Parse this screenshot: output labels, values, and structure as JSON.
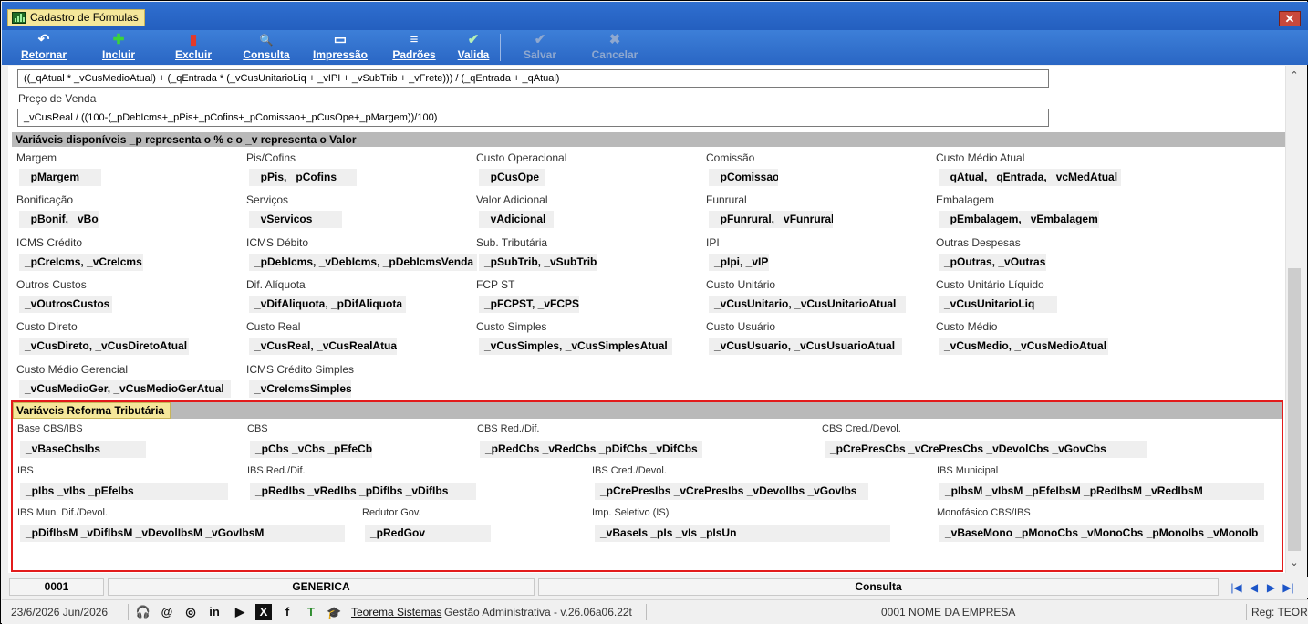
{
  "window": {
    "title": "Cadastro de Fórmulas",
    "close_glyph": "✕"
  },
  "toolbar": {
    "buttons": [
      {
        "label": "Retornar",
        "icon": "↶"
      },
      {
        "label": "Incluir",
        "icon": "✚"
      },
      {
        "label": "Excluir",
        "icon": "▮"
      },
      {
        "label": "Consulta",
        "icon": "🔍"
      },
      {
        "label": "Impressão",
        "icon": "▭"
      },
      {
        "label": "Padrões",
        "icon": "≡"
      },
      {
        "label": "Valida",
        "icon": "✔"
      },
      {
        "label": "Salvar",
        "icon": "✔"
      },
      {
        "label": "Cancelar",
        "icon": "✖"
      }
    ]
  },
  "formulas": {
    "custo_medio": "((_qAtual * _vCusMedioAtual) + (_qEntrada * (_vCusUnitarioLiq + _vIPI + _vSubTrib + _vFrete))) / (_qEntrada + _qAtual)",
    "preco_venda_label": "Preço de Venda",
    "preco_venda": "_vCusReal / ((100-(_pDebIcms+_pPis+_pCofins+_pComissao+_pCusOpe+_pMargem))/100)"
  },
  "variables": {
    "header": "Variáveis disponíveis _p representa o % e o _v representa o Valor",
    "items": [
      {
        "label": "Margem",
        "value": "_pMargem"
      },
      {
        "label": "Pis/Cofins",
        "value": "_pPis, _pCofins"
      },
      {
        "label": "Custo Operacional",
        "value": "_pCusOpe"
      },
      {
        "label": "Comissão",
        "value": "_pComissao"
      },
      {
        "label": "Custo Médio Atual",
        "value": "_qAtual, _qEntrada, _vcMedAtual"
      },
      {
        "label": "Bonificação",
        "value": "_pBonif, _vBonif"
      },
      {
        "label": "Serviços",
        "value": "_vServicos"
      },
      {
        "label": "Valor Adicional",
        "value": "_vAdicional"
      },
      {
        "label": "Funrural",
        "value": "_pFunrural, _vFunrural"
      },
      {
        "label": "Embalagem",
        "value": "_pEmbalagem, _vEmbalagem"
      },
      {
        "label": "ICMS Crédito",
        "value": "_pCreIcms, _vCreIcms"
      },
      {
        "label": "ICMS Débito",
        "value": "_pDebIcms, _vDebIcms, _pDebIcmsVenda"
      },
      {
        "label": "Sub. Tributária",
        "value": "_pSubTrib, _vSubTrib"
      },
      {
        "label": "IPI",
        "value": "_pIpi, _vIPI"
      },
      {
        "label": "Outras Despesas",
        "value": "_pOutras, _vOutras"
      },
      {
        "label": "Outros Custos",
        "value": "_vOutrosCustos"
      },
      {
        "label": "Dif. Alíquota",
        "value": "_vDifAliquota, _pDifAliquota"
      },
      {
        "label": "FCP ST",
        "value": "_pFCPST, _vFCPST"
      },
      {
        "label": "Custo Unitário",
        "value": "_vCusUnitario, _vCusUnitarioAtual"
      },
      {
        "label": "Custo Unitário Líquido",
        "value": "_vCusUnitarioLiq"
      },
      {
        "label": "Custo Direto",
        "value": "_vCusDireto, _vCusDiretoAtual"
      },
      {
        "label": "Custo Real",
        "value": "_vCusReal, _vCusRealAtual"
      },
      {
        "label": "Custo Simples",
        "value": "_vCusSimples, _vCusSimplesAtual"
      },
      {
        "label": "Custo Usuário",
        "value": "_vCusUsuario, _vCusUsuarioAtual"
      },
      {
        "label": "Custo Médio",
        "value": "_vCusMedio, _vCusMedioAtual"
      },
      {
        "label": "Custo Médio Gerencial",
        "value": "_vCusMedioGer, _vCusMedioGerAtual"
      },
      {
        "label": "ICMS Crédito Simples",
        "value": "_vCreIcmsSimples"
      }
    ]
  },
  "reforma": {
    "header": "Variáveis Reforma Tributária",
    "items": [
      {
        "label": "Base CBS/IBS",
        "value": "_vBaseCbsIbs"
      },
      {
        "label": "CBS",
        "value": "_pCbs _vCbs _pEfeCbs"
      },
      {
        "label": "CBS Red./Dif.",
        "value": "_pRedCbs _vRedCbs _pDifCbs _vDifCbs"
      },
      {
        "label": "CBS Cred./Devol.",
        "value": "_pCrePresCbs _vCrePresCbs _vDevolCbs _vGovCbs"
      },
      {
        "label": "IBS",
        "value": "_pIbs _vIbs _pEfeIbs"
      },
      {
        "label": "IBS Red./Dif.",
        "value": "_pRedIbs _vRedIbs _pDifIbs _vDifIbs"
      },
      {
        "label": "IBS Cred./Devol.",
        "value": "_pCrePresIbs _vCrePresIbs _vDevolIbs _vGovIbs"
      },
      {
        "label": "IBS Municipal",
        "value": "_pIbsM _vIbsM _pEfeIbsM _pRedIbsM _vRedIbsM"
      },
      {
        "label": "IBS Mun. Dif./Devol.",
        "value": "_pDifIbsM _vDifIbsM _vDevolIbsM _vGovIbsM"
      },
      {
        "label": "Redutor Gov.",
        "value": "_pRedGov"
      },
      {
        "label": "Imp. Seletivo (IS)",
        "value": "_vBaseIs _pIs _vIs _pIsUn"
      },
      {
        "label": "Monofásico CBS/IBS",
        "value": "_vBaseMono _pMonoCbs _vMonoCbs _pMonoIbs _vMonoIb"
      }
    ]
  },
  "status": {
    "code": "0001",
    "name": "GENERICA",
    "mode": "Consulta",
    "nav": [
      "|◀",
      "◀",
      "▶",
      "▶|"
    ]
  },
  "footer": {
    "date": "23/6/2026 Jun/2026",
    "company_link": "Teorema Sistemas",
    "version": "Gestão Administrativa - v.26.06a06.22t",
    "empresa": "0001 NOME DA EMPRESA",
    "reg": "Reg: TEOR",
    "social": [
      "🎧",
      "@",
      "◎",
      "in",
      "▶",
      "X",
      "f",
      "T"
    ]
  }
}
